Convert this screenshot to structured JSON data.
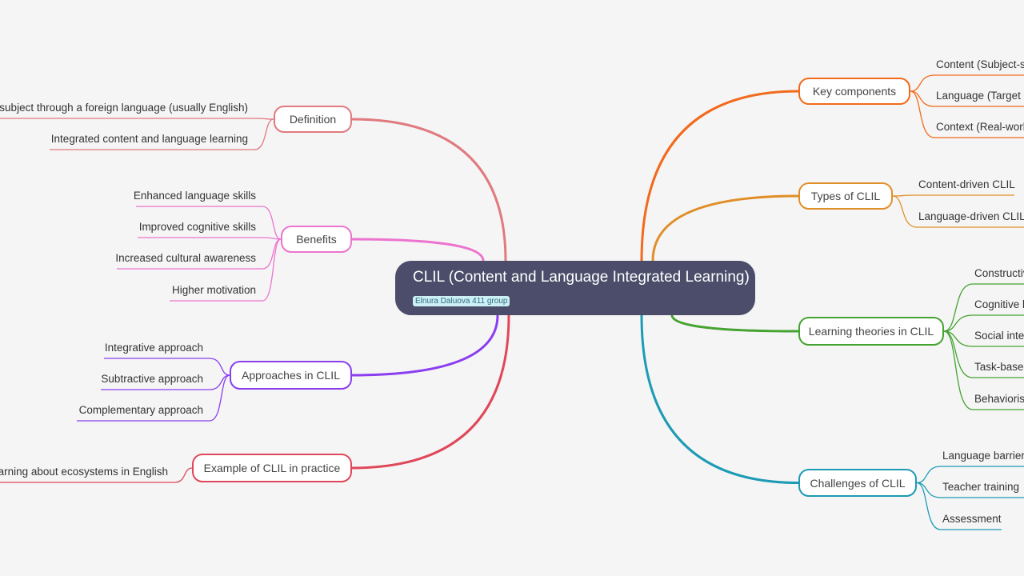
{
  "root": {
    "title": "CLIL (Content and Language Integrated Learning)",
    "label": "Elnura Daluova 411 group"
  },
  "branches": [
    {
      "id": "definition",
      "title": "Definition",
      "side": "left",
      "color": "#e07a7f",
      "children": [
        "Teaching a subject through a foreign language (usually English)",
        "Integrated content and language learning"
      ]
    },
    {
      "id": "benefits",
      "title": "Benefits",
      "side": "left",
      "color": "#ec74cf",
      "children": [
        "Enhanced language skills",
        "Improved cognitive skills",
        "Increased cultural awareness",
        "Higher motivation"
      ]
    },
    {
      "id": "approaches",
      "title": "Approaches in CLIL",
      "side": "left",
      "color": "#8a3ef0",
      "children": [
        "Integrative approach",
        "Subtractive approach",
        "Complementary approach"
      ]
    },
    {
      "id": "example",
      "title": "Example of CLIL in practice",
      "side": "left",
      "color": "#e0475a",
      "children": [
        "Science lesson learning about ecosystems in English"
      ]
    },
    {
      "id": "key-components",
      "title": "Key components",
      "side": "right",
      "color": "#f26a1b",
      "children": [
        "Content (Subject-specific knowledge)",
        "Language (Target language)",
        "Context (Real-world situations)"
      ]
    },
    {
      "id": "types",
      "title": "Types of CLIL",
      "side": "right",
      "color": "#e08f28",
      "children": [
        "Content-driven CLIL",
        "Language-driven CLIL"
      ]
    },
    {
      "id": "learning-theories",
      "title": "Learning theories in CLIL",
      "side": "right",
      "color": "#45a332",
      "children": [
        "Constructivism",
        "Cognitive learning",
        "Social interaction",
        "Task-based learning",
        "Behaviorism"
      ]
    },
    {
      "id": "challenges",
      "title": "Challenges of CLIL",
      "side": "right",
      "color": "#1d9bb4",
      "children": [
        "Language barriers",
        "Teacher training",
        "Assessment"
      ]
    }
  ]
}
